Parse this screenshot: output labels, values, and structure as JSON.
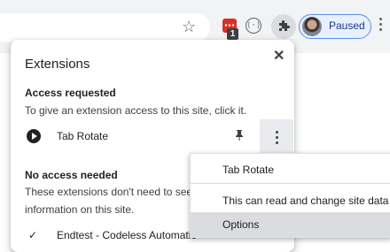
{
  "toolbar": {
    "profile_status": "Paused",
    "extension_badge_count": "1",
    "code_icon_glyph": "⟨·⟩"
  },
  "extensions_panel": {
    "title": "Extensions",
    "close_glyph": "✕",
    "access_requested": {
      "heading": "Access requested",
      "description": "To give an extension access to this site, click it.",
      "extension": {
        "name": "Tab Rotate",
        "icon": "play-circle-icon"
      }
    },
    "no_access_needed": {
      "heading": "No access needed",
      "description": "These extensions don't need to see",
      "description_2": "information on this site.",
      "extension": {
        "name": "Endtest - Codeless Automatio",
        "icon": "check-icon"
      }
    }
  },
  "context_menu": {
    "items": [
      {
        "label": "Tab Rotate"
      },
      {
        "label": "This can read and change site data"
      },
      {
        "label": "Options"
      }
    ]
  },
  "colors": {
    "toolbar_bg": "#f1f3f4",
    "menu_hover": "#dadce0",
    "paused_border": "#5b8de8"
  }
}
